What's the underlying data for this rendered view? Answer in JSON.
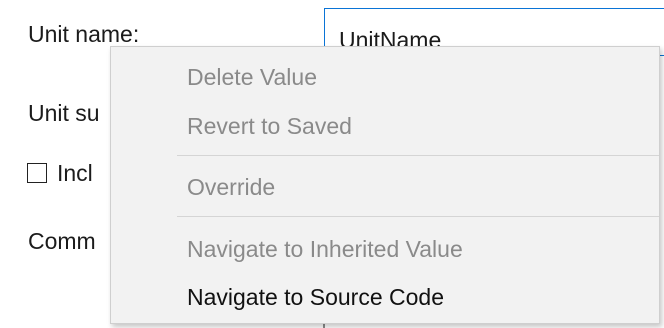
{
  "form": {
    "unit_name_label": "Unit name:",
    "unit_name_value": "UnitName",
    "unit_suffix_label": "Unit su",
    "include_label": "Incl",
    "comment_label": "Comm"
  },
  "context_menu": {
    "items": [
      {
        "label": "Delete Value",
        "enabled": false
      },
      {
        "label": "Revert to Saved",
        "enabled": false
      },
      {
        "label": "Override",
        "enabled": false
      },
      {
        "label": "Navigate to Inherited Value",
        "enabled": false
      },
      {
        "label": "Navigate to Source Code",
        "enabled": true
      }
    ]
  },
  "colors": {
    "input_focus_border": "#0a74d6",
    "menu_background": "#f2f2f2",
    "disabled_text": "#8a8a8a",
    "enabled_text": "#111111"
  }
}
